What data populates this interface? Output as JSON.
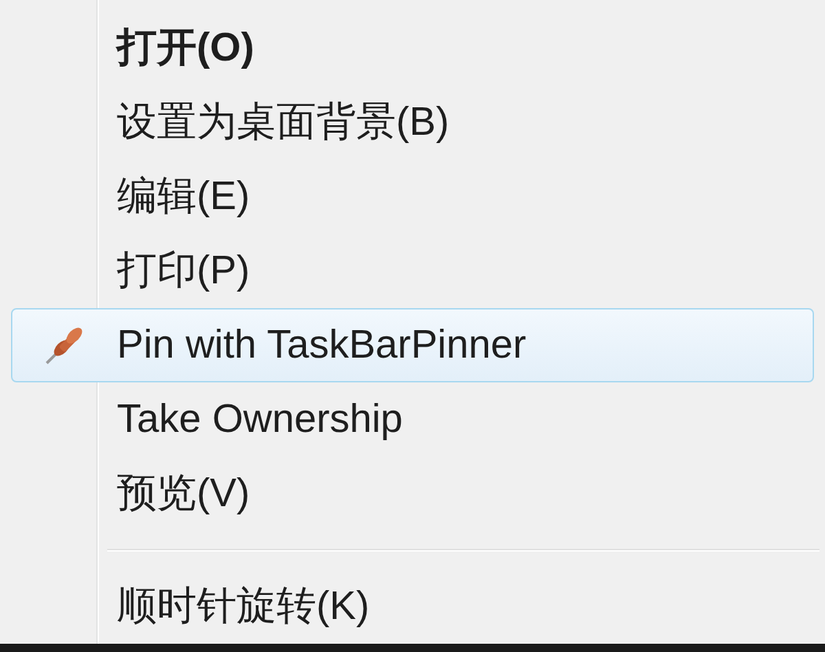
{
  "menu": {
    "items": [
      {
        "kind": "item",
        "label": "打开(O)",
        "bold": true,
        "selected": false,
        "has_icon": false
      },
      {
        "kind": "item",
        "label": "设置为桌面背景(B)",
        "bold": false,
        "selected": false,
        "has_icon": false
      },
      {
        "kind": "item",
        "label": "编辑(E)",
        "bold": false,
        "selected": false,
        "has_icon": false
      },
      {
        "kind": "item",
        "label": "打印(P)",
        "bold": false,
        "selected": false,
        "has_icon": false
      },
      {
        "kind": "item",
        "label": "Pin with TaskBarPinner",
        "bold": false,
        "selected": true,
        "has_icon": true
      },
      {
        "kind": "item",
        "label": "Take Ownership",
        "bold": false,
        "selected": false,
        "has_icon": false
      },
      {
        "kind": "item",
        "label": "预览(V)",
        "bold": false,
        "selected": false,
        "has_icon": false
      },
      {
        "kind": "separator"
      },
      {
        "kind": "item",
        "label": "顺时针旋转(K)",
        "bold": false,
        "selected": false,
        "has_icon": false
      }
    ]
  }
}
